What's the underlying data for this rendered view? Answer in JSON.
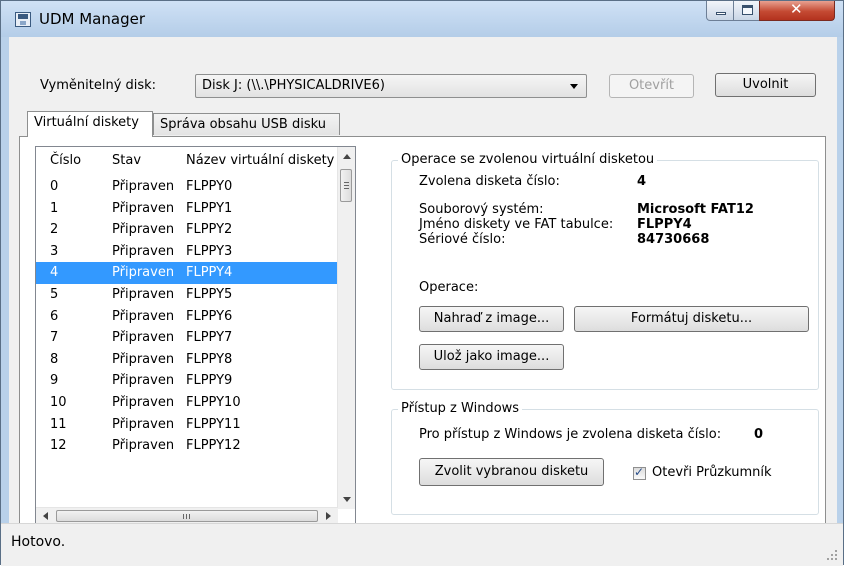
{
  "window": {
    "title": "UDM Manager"
  },
  "toolbar": {
    "disk_label": "Vyměnitelný disk:",
    "disk_value": "Disk J: (\\\\.\\PHYSICALDRIVE6)",
    "open_button": "Otevřít",
    "release_button": "Uvolnit"
  },
  "tabs": [
    {
      "label": "Virtuální diskety",
      "active": true
    },
    {
      "label": "Správa obsahu USB disku",
      "active": false
    }
  ],
  "list": {
    "columns": [
      "Číslo",
      "Stav",
      "Název virtuální diskety"
    ],
    "rows": [
      {
        "number": "0",
        "state": "Připraven",
        "name": "FLPPY0"
      },
      {
        "number": "1",
        "state": "Připraven",
        "name": "FLPPY1"
      },
      {
        "number": "2",
        "state": "Připraven",
        "name": "FLPPY2"
      },
      {
        "number": "3",
        "state": "Připraven",
        "name": "FLPPY3"
      },
      {
        "number": "4",
        "state": "Připraven",
        "name": "FLPPY4"
      },
      {
        "number": "5",
        "state": "Připraven",
        "name": "FLPPY5"
      },
      {
        "number": "6",
        "state": "Připraven",
        "name": "FLPPY6"
      },
      {
        "number": "7",
        "state": "Připraven",
        "name": "FLPPY7"
      },
      {
        "number": "8",
        "state": "Připraven",
        "name": "FLPPY8"
      },
      {
        "number": "9",
        "state": "Připraven",
        "name": "FLPPY9"
      },
      {
        "number": "10",
        "state": "Připraven",
        "name": "FLPPY10"
      },
      {
        "number": "11",
        "state": "Připraven",
        "name": "FLPPY11"
      },
      {
        "number": "12",
        "state": "Připraven",
        "name": "FLPPY12"
      }
    ],
    "selected_number": "4"
  },
  "operations_group": {
    "title": "Operace se zvolenou virtuální disketou",
    "selected_label": "Zvolena disketa číslo:",
    "selected_value": "4",
    "fs_label": "Souborový systém:",
    "fs_value": "Microsoft FAT12",
    "fat_name_label": "Jméno diskety ve FAT tabulce:",
    "fat_name_value": "FLPPY4",
    "serial_label": "Sériové číslo:",
    "serial_value": "84730668",
    "operations_label": "Operace:",
    "replace_button": "Nahraď z image...",
    "format_button": "Formátuj disketu...",
    "save_button": "Ulož jako image..."
  },
  "windows_group": {
    "title": "Přístup z Windows",
    "info_label": "Pro přístup z Windows je zvolena disketa číslo:",
    "info_value": "0",
    "choose_button": "Zvolit vybranou disketu",
    "explorer_checkbox": "Otevři Průzkumník",
    "explorer_checked": true
  },
  "status": {
    "text": "Hotovo."
  },
  "colors": {
    "selection": "#3399ff",
    "titlebar": "#b9d1ea",
    "close": "#c44a33"
  }
}
